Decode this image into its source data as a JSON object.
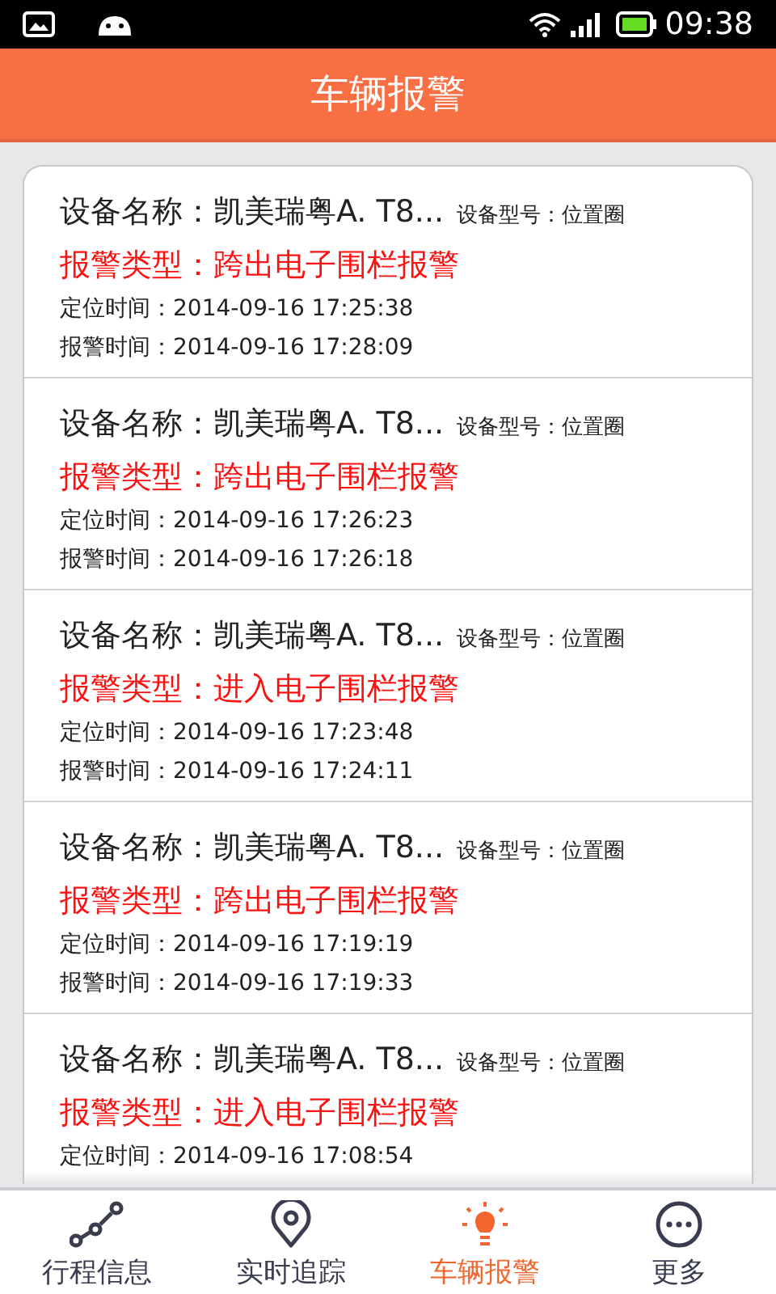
{
  "status_bar": {
    "time": "09:38"
  },
  "header": {
    "title": "车辆报警"
  },
  "alarms": [
    {
      "device": "设备名称：凯美瑞粤A. T8...",
      "model": "设备型号：位置圈",
      "alarm_type": "报警类型：跨出电子围栏报警",
      "located_time": "定位时间：2014-09-16 17:25:38",
      "alarm_time": "报警时间：2014-09-16 17:28:09"
    },
    {
      "device": "设备名称：凯美瑞粤A. T8...",
      "model": "设备型号：位置圈",
      "alarm_type": "报警类型：跨出电子围栏报警",
      "located_time": "定位时间：2014-09-16 17:26:23",
      "alarm_time": "报警时间：2014-09-16 17:26:18"
    },
    {
      "device": "设备名称：凯美瑞粤A. T8...",
      "model": "设备型号：位置圈",
      "alarm_type": "报警类型：进入电子围栏报警",
      "located_time": "定位时间：2014-09-16 17:23:48",
      "alarm_time": "报警时间：2014-09-16 17:24:11"
    },
    {
      "device": "设备名称：凯美瑞粤A. T8...",
      "model": "设备型号：位置圈",
      "alarm_type": "报警类型：跨出电子围栏报警",
      "located_time": "定位时间：2014-09-16 17:19:19",
      "alarm_time": "报警时间：2014-09-16 17:19:33"
    },
    {
      "device": "设备名称：凯美瑞粤A. T8...",
      "model": "设备型号：位置圈",
      "alarm_type": "报警类型：进入电子围栏报警",
      "located_time": "定位时间：2014-09-16 17:08:54"
    }
  ],
  "bottom_nav": [
    {
      "kind": "route",
      "label": "行程信息",
      "selected": false
    },
    {
      "kind": "location",
      "label": "实时追踪",
      "selected": false
    },
    {
      "kind": "bulb",
      "label": "车辆报警",
      "selected": true
    },
    {
      "kind": "more",
      "label": "更多",
      "selected": false
    }
  ]
}
